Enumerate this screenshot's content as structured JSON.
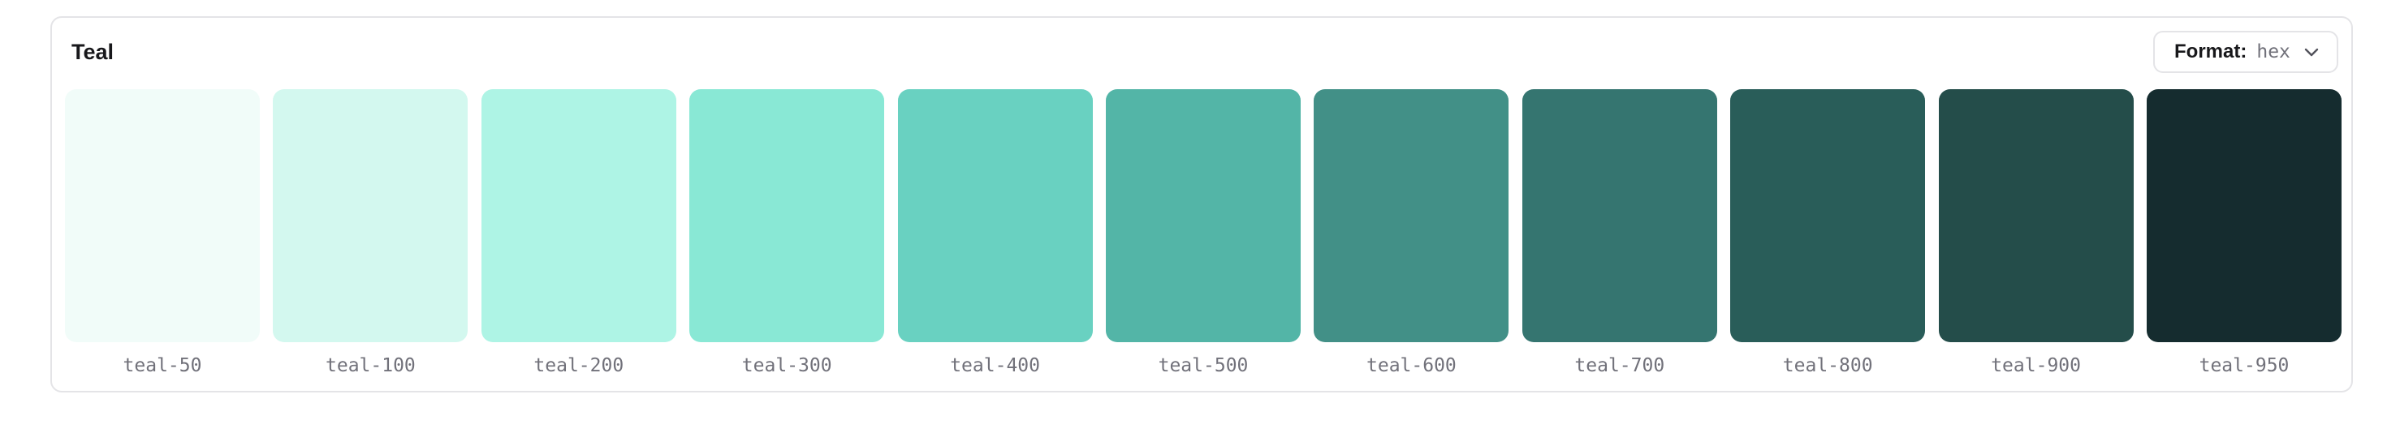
{
  "palette": {
    "title": "Teal",
    "format": {
      "label": "Format:",
      "value": "hex",
      "icon": "chevron-down-icon"
    },
    "swatches": [
      {
        "name": "teal-50",
        "color": "#f1fcf9"
      },
      {
        "name": "teal-100",
        "color": "#d3f8ef"
      },
      {
        "name": "teal-200",
        "color": "#aef4e5"
      },
      {
        "name": "teal-300",
        "color": "#89e8d5"
      },
      {
        "name": "teal-400",
        "color": "#69d1c1"
      },
      {
        "name": "teal-500",
        "color": "#53b5a7"
      },
      {
        "name": "teal-600",
        "color": "#429087"
      },
      {
        "name": "teal-700",
        "color": "#357570"
      },
      {
        "name": "teal-800",
        "color": "#295d59"
      },
      {
        "name": "teal-900",
        "color": "#244d4a"
      },
      {
        "name": "teal-950",
        "color": "#152c2f"
      }
    ]
  }
}
